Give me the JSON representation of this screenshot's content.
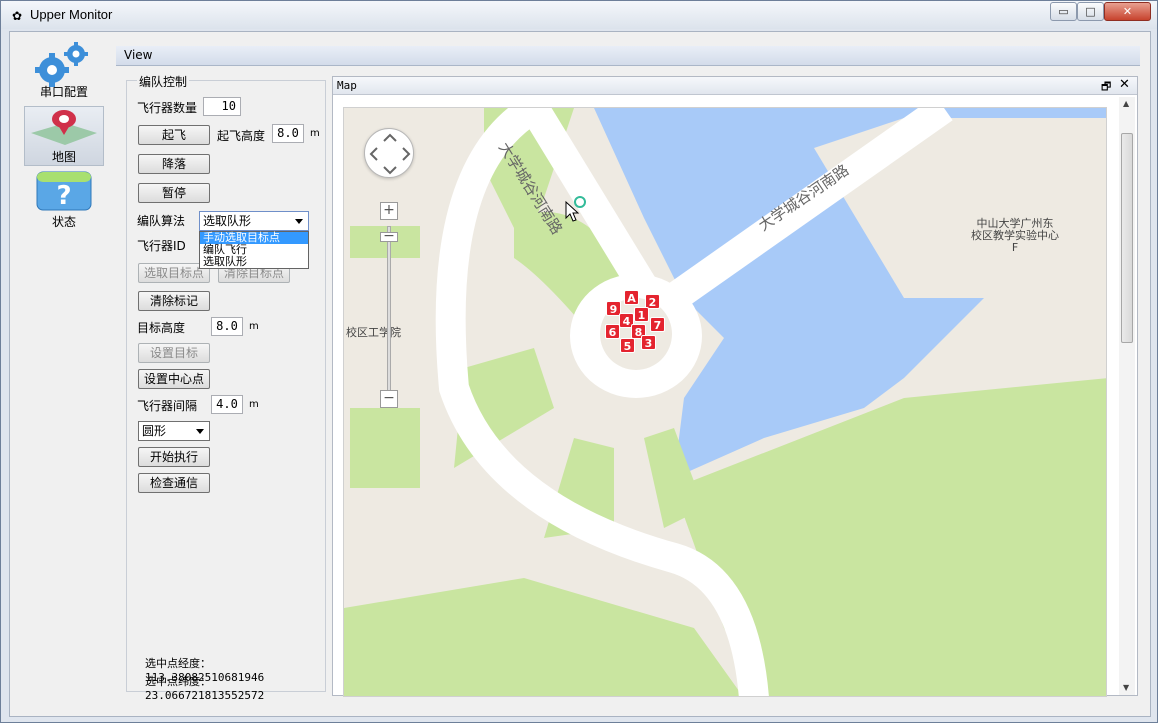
{
  "window": {
    "title": "Upper Monitor",
    "min_symbol": "▭",
    "max_symbol": "□",
    "close_symbol": "✕"
  },
  "sidebar": {
    "items": [
      {
        "label": "串口配置",
        "icon": "gears-icon"
      },
      {
        "label": "地图",
        "icon": "map-pin-icon"
      },
      {
        "label": "状态",
        "icon": "question-icon"
      }
    ]
  },
  "view_title": "View",
  "formation": {
    "group_title": "编队控制",
    "aircraft_count_label": "飞行器数量",
    "aircraft_count": "10",
    "takeoff_button": "起飞",
    "takeoff_height_label": "起飞高度",
    "takeoff_height": "8.0",
    "unit_m": "m",
    "land_button": "降落",
    "pause_button": "暂停",
    "algorithm_label": "编队算法",
    "algorithm_value": "选取队形",
    "algorithm_options": [
      "手动选取目标点",
      "编队飞行",
      "选取队形"
    ],
    "aircraft_id_label": "飞行器ID",
    "select_target_button": "选取目标点",
    "clear_target_button": "清除目标点",
    "clear_marks_button": "清除标记",
    "target_height_label": "目标高度",
    "target_height": "8.0",
    "set_target_button": "设置目标",
    "set_center_button": "设置中心点",
    "spacing_label": "飞行器间隔",
    "spacing": "4.0",
    "shape_value": "圆形",
    "start_button": "开始执行",
    "check_comm_button": "检查通信",
    "lon_label": "选中点经度：",
    "lon_value": "113.38082510681946",
    "lat_label": "选中点纬度：",
    "lat_value": "23.066721813552572"
  },
  "map": {
    "title": "Map",
    "float_symbol": "🗗",
    "close_symbol": "✕",
    "road_top": "大学城谷河南路",
    "road_left": "大学城谷河南路",
    "place_1_line1": "中山大学广州东",
    "place_1_line2": "校区教学实验中心F",
    "place_2": "校区工学院",
    "zoom_in": "+",
    "zoom_out": "−",
    "pins": [
      "A",
      "2",
      "9",
      "1",
      "4",
      "7",
      "6",
      "8",
      "5",
      "3"
    ],
    "colors": {
      "water": "#a8caf8",
      "grass": "#c9e5a0",
      "road": "#ffffff",
      "land": "#eeeae2",
      "pin": "#e4242f"
    }
  }
}
